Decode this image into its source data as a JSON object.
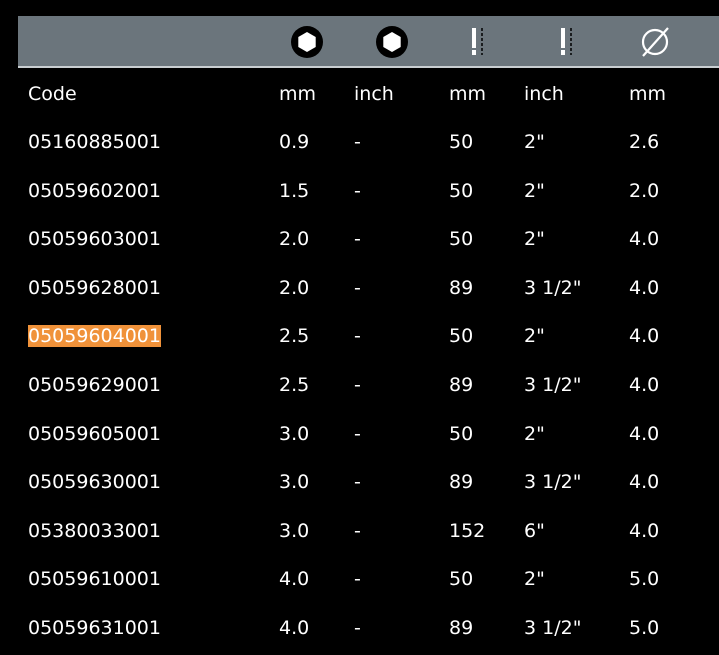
{
  "header_icons": [
    "hex-socket-icon",
    "hex-socket-icon",
    "bit-length-icon",
    "bit-length-icon",
    "diameter-icon"
  ],
  "columns": [
    "Code",
    "mm",
    "inch",
    "mm",
    "inch",
    "mm"
  ],
  "rows": [
    [
      "05160885001",
      "0.9",
      "-",
      "50",
      "2\"",
      "2.6"
    ],
    [
      "05059602001",
      "1.5",
      "-",
      "50",
      "2\"",
      "2.0"
    ],
    [
      "05059603001",
      "2.0",
      "-",
      "50",
      "2\"",
      "4.0"
    ],
    [
      "05059628001",
      "2.0",
      "-",
      "89",
      "3 1/2\"",
      "4.0"
    ],
    [
      "05059604001",
      "2.5",
      "-",
      "50",
      "2\"",
      "4.0"
    ],
    [
      "05059629001",
      "2.5",
      "-",
      "89",
      "3 1/2\"",
      "4.0"
    ],
    [
      "05059605001",
      "3.0",
      "-",
      "50",
      "2\"",
      "4.0"
    ],
    [
      "05059630001",
      "3.0",
      "-",
      "89",
      "3 1/2\"",
      "4.0"
    ],
    [
      "05380033001",
      "3.0",
      "-",
      "152",
      "6\"",
      "4.0"
    ],
    [
      "05059610001",
      "4.0",
      "-",
      "50",
      "2\"",
      "5.0"
    ],
    [
      "05059631001",
      "4.0",
      "-",
      "89",
      "3 1/2\"",
      "5.0"
    ]
  ],
  "highlighted_code": "05059604001",
  "colors": {
    "header_bar": "#6b757c",
    "highlight": "#f0923a",
    "background": "#000000",
    "text": "#ffffff"
  }
}
